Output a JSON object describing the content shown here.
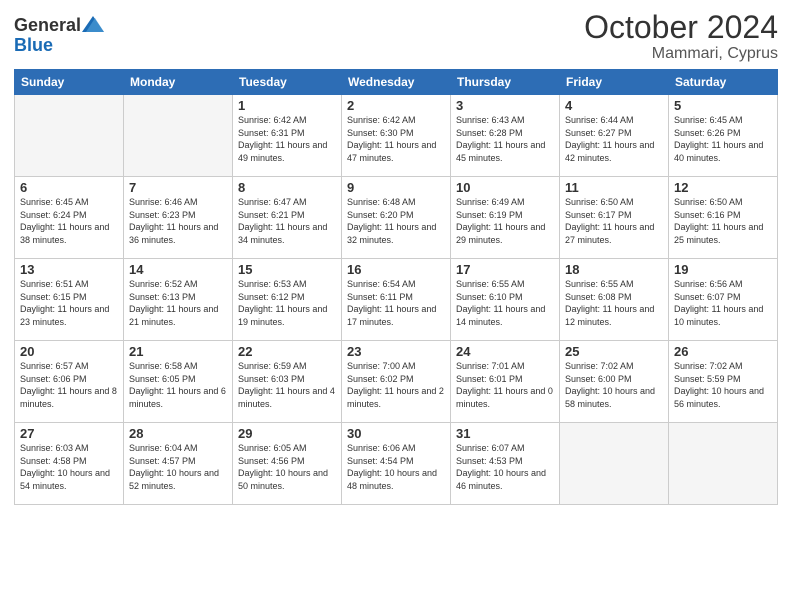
{
  "header": {
    "logo_general": "General",
    "logo_blue": "Blue",
    "month_year": "October 2024",
    "location": "Mammari, Cyprus"
  },
  "weekdays": [
    "Sunday",
    "Monday",
    "Tuesday",
    "Wednesday",
    "Thursday",
    "Friday",
    "Saturday"
  ],
  "weeks": [
    [
      {
        "day": "",
        "info": ""
      },
      {
        "day": "",
        "info": ""
      },
      {
        "day": "1",
        "info": "Sunrise: 6:42 AM\nSunset: 6:31 PM\nDaylight: 11 hours and 49 minutes."
      },
      {
        "day": "2",
        "info": "Sunrise: 6:42 AM\nSunset: 6:30 PM\nDaylight: 11 hours and 47 minutes."
      },
      {
        "day": "3",
        "info": "Sunrise: 6:43 AM\nSunset: 6:28 PM\nDaylight: 11 hours and 45 minutes."
      },
      {
        "day": "4",
        "info": "Sunrise: 6:44 AM\nSunset: 6:27 PM\nDaylight: 11 hours and 42 minutes."
      },
      {
        "day": "5",
        "info": "Sunrise: 6:45 AM\nSunset: 6:26 PM\nDaylight: 11 hours and 40 minutes."
      }
    ],
    [
      {
        "day": "6",
        "info": "Sunrise: 6:45 AM\nSunset: 6:24 PM\nDaylight: 11 hours and 38 minutes."
      },
      {
        "day": "7",
        "info": "Sunrise: 6:46 AM\nSunset: 6:23 PM\nDaylight: 11 hours and 36 minutes."
      },
      {
        "day": "8",
        "info": "Sunrise: 6:47 AM\nSunset: 6:21 PM\nDaylight: 11 hours and 34 minutes."
      },
      {
        "day": "9",
        "info": "Sunrise: 6:48 AM\nSunset: 6:20 PM\nDaylight: 11 hours and 32 minutes."
      },
      {
        "day": "10",
        "info": "Sunrise: 6:49 AM\nSunset: 6:19 PM\nDaylight: 11 hours and 29 minutes."
      },
      {
        "day": "11",
        "info": "Sunrise: 6:50 AM\nSunset: 6:17 PM\nDaylight: 11 hours and 27 minutes."
      },
      {
        "day": "12",
        "info": "Sunrise: 6:50 AM\nSunset: 6:16 PM\nDaylight: 11 hours and 25 minutes."
      }
    ],
    [
      {
        "day": "13",
        "info": "Sunrise: 6:51 AM\nSunset: 6:15 PM\nDaylight: 11 hours and 23 minutes."
      },
      {
        "day": "14",
        "info": "Sunrise: 6:52 AM\nSunset: 6:13 PM\nDaylight: 11 hours and 21 minutes."
      },
      {
        "day": "15",
        "info": "Sunrise: 6:53 AM\nSunset: 6:12 PM\nDaylight: 11 hours and 19 minutes."
      },
      {
        "day": "16",
        "info": "Sunrise: 6:54 AM\nSunset: 6:11 PM\nDaylight: 11 hours and 17 minutes."
      },
      {
        "day": "17",
        "info": "Sunrise: 6:55 AM\nSunset: 6:10 PM\nDaylight: 11 hours and 14 minutes."
      },
      {
        "day": "18",
        "info": "Sunrise: 6:55 AM\nSunset: 6:08 PM\nDaylight: 11 hours and 12 minutes."
      },
      {
        "day": "19",
        "info": "Sunrise: 6:56 AM\nSunset: 6:07 PM\nDaylight: 11 hours and 10 minutes."
      }
    ],
    [
      {
        "day": "20",
        "info": "Sunrise: 6:57 AM\nSunset: 6:06 PM\nDaylight: 11 hours and 8 minutes."
      },
      {
        "day": "21",
        "info": "Sunrise: 6:58 AM\nSunset: 6:05 PM\nDaylight: 11 hours and 6 minutes."
      },
      {
        "day": "22",
        "info": "Sunrise: 6:59 AM\nSunset: 6:03 PM\nDaylight: 11 hours and 4 minutes."
      },
      {
        "day": "23",
        "info": "Sunrise: 7:00 AM\nSunset: 6:02 PM\nDaylight: 11 hours and 2 minutes."
      },
      {
        "day": "24",
        "info": "Sunrise: 7:01 AM\nSunset: 6:01 PM\nDaylight: 11 hours and 0 minutes."
      },
      {
        "day": "25",
        "info": "Sunrise: 7:02 AM\nSunset: 6:00 PM\nDaylight: 10 hours and 58 minutes."
      },
      {
        "day": "26",
        "info": "Sunrise: 7:02 AM\nSunset: 5:59 PM\nDaylight: 10 hours and 56 minutes."
      }
    ],
    [
      {
        "day": "27",
        "info": "Sunrise: 6:03 AM\nSunset: 4:58 PM\nDaylight: 10 hours and 54 minutes."
      },
      {
        "day": "28",
        "info": "Sunrise: 6:04 AM\nSunset: 4:57 PM\nDaylight: 10 hours and 52 minutes."
      },
      {
        "day": "29",
        "info": "Sunrise: 6:05 AM\nSunset: 4:56 PM\nDaylight: 10 hours and 50 minutes."
      },
      {
        "day": "30",
        "info": "Sunrise: 6:06 AM\nSunset: 4:54 PM\nDaylight: 10 hours and 48 minutes."
      },
      {
        "day": "31",
        "info": "Sunrise: 6:07 AM\nSunset: 4:53 PM\nDaylight: 10 hours and 46 minutes."
      },
      {
        "day": "",
        "info": ""
      },
      {
        "day": "",
        "info": ""
      }
    ]
  ]
}
